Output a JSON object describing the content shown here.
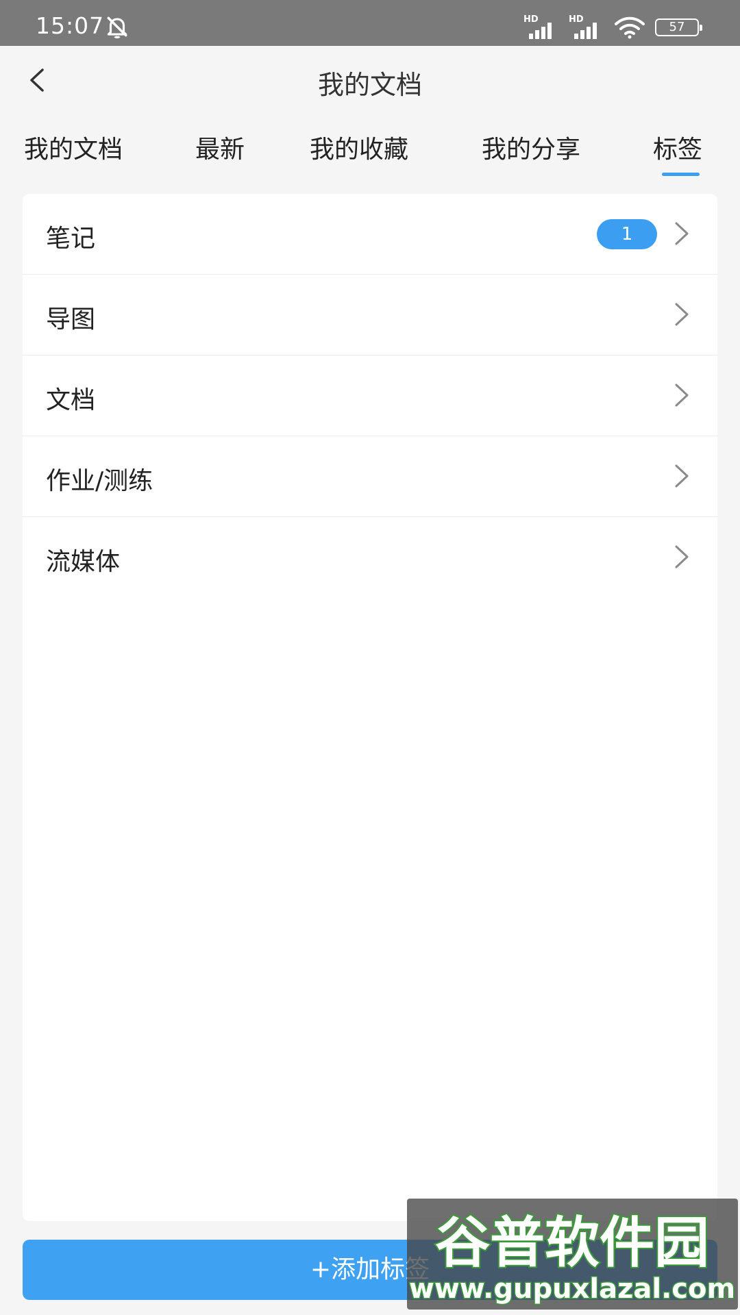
{
  "status_bar": {
    "time": "15:07",
    "signal_1_label": "HD",
    "signal_2_label": "HD",
    "battery": "57",
    "icons": [
      "bell-muted-icon",
      "signal-icon",
      "wifi-icon",
      "battery-icon"
    ]
  },
  "nav": {
    "title": "我的文档",
    "back_icon": "chevron-left-icon"
  },
  "tabs": [
    {
      "label": "我的文档",
      "active": false
    },
    {
      "label": "最新",
      "active": false
    },
    {
      "label": "我的收藏",
      "active": false
    },
    {
      "label": "我的分享",
      "active": false
    },
    {
      "label": "标签",
      "active": true
    }
  ],
  "tag_list": [
    {
      "label": "笔记",
      "badge": "1"
    },
    {
      "label": "导图"
    },
    {
      "label": "文档"
    },
    {
      "label": "作业/测练"
    },
    {
      "label": "流媒体"
    }
  ],
  "add_button": {
    "label": "+添加标签"
  },
  "watermark": {
    "title": "谷普软件园",
    "url": "www.gupuxlazal.com"
  },
  "colors": {
    "accent": "#3b9ef0",
    "status_bar": "#7a7a7a",
    "background": "#f5f5f5"
  }
}
